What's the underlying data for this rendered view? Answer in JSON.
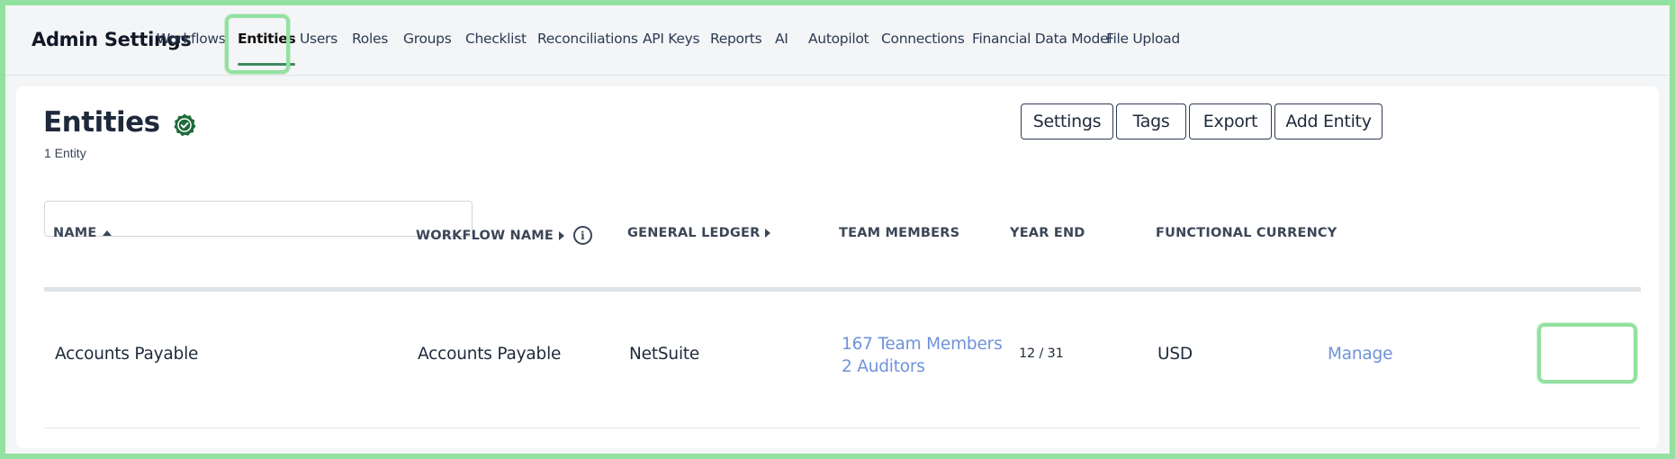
{
  "header": {
    "title": "Admin Settings",
    "nav": [
      {
        "label": "Workflows",
        "active": false
      },
      {
        "label": "Entities",
        "active": true
      },
      {
        "label": "Users",
        "active": false
      },
      {
        "label": "Roles",
        "active": false
      },
      {
        "label": "Groups",
        "active": false
      },
      {
        "label": "Checklist",
        "active": false
      },
      {
        "label": "Reconciliations",
        "active": false
      },
      {
        "label": "API Keys",
        "active": false
      },
      {
        "label": "Reports",
        "active": false
      },
      {
        "label": "AI",
        "active": false
      },
      {
        "label": "Autopilot",
        "active": false
      },
      {
        "label": "Connections",
        "active": false
      },
      {
        "label": "Financial Data Model",
        "active": false
      },
      {
        "label": "File Upload",
        "active": false
      }
    ]
  },
  "page": {
    "title": "Entities",
    "subtitle": "1 Entity",
    "status_icon": "verified-badge-icon",
    "actions": {
      "settings": "Settings",
      "tags": "Tags",
      "export": "Export",
      "add_entity": "Add Entity"
    },
    "search": {
      "value": "",
      "placeholder": ""
    }
  },
  "table": {
    "columns": {
      "name": "NAME",
      "workflow_name": "WORKFLOW NAME",
      "general_ledger": "GENERAL LEDGER",
      "team_members": "TEAM MEMBERS",
      "year_end": "YEAR END",
      "functional_currency": "FUNCTIONAL CURRENCY"
    },
    "rows": [
      {
        "name": "Accounts Payable",
        "workflow_name": "Accounts Payable",
        "general_ledger": "NetSuite",
        "team_members": "167 Team Members",
        "auditors": "2 Auditors",
        "year_end": "12 / 31",
        "functional_currency": "USD",
        "action": "Manage"
      }
    ]
  },
  "colors": {
    "highlight": "#93e1a0",
    "active_tab_underline": "#3f8a62",
    "link": "#6e92da",
    "badge": "#1f6b3a"
  }
}
